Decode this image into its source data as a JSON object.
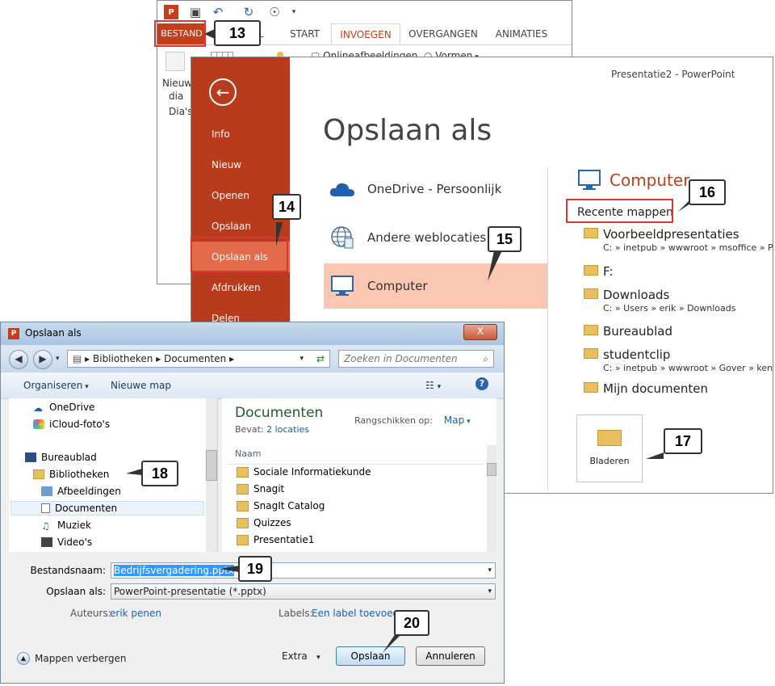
{
  "ppt_back": {
    "tabs": [
      "BESTAND",
      "START",
      "INVOEGEN",
      "OVERGANGEN",
      "ANIMATIES"
    ],
    "partial_tab": "L",
    "ribbon": {
      "new_slide_line1": "Nieuw",
      "new_slide_line2": "dia",
      "group_slides": "Dia's",
      "online_images": "Onlineafbeeldingen",
      "shapes": "Vormen"
    }
  },
  "backstage": {
    "window_title": "Presentatie2 - PowerPoint",
    "heading": "Opslaan als",
    "nav": [
      "Info",
      "Nieuw",
      "Openen",
      "Opslaan",
      "Opslaan als",
      "Afdrukken",
      "Delen"
    ],
    "places": [
      "OneDrive - Persoonlijk",
      "Andere weblocaties",
      "Computer"
    ],
    "computer_title": "Computer",
    "recent_label": "Recente mappen",
    "recent_folders": [
      {
        "name": "Voorbeeldpresentaties",
        "path": "C: » inetpub » wwwroot » msoffice » Pow"
      },
      {
        "name": "F:",
        "path": ""
      },
      {
        "name": "Downloads",
        "path": "C: » Users » erik » Downloads"
      },
      {
        "name": "Bureaublad",
        "path": ""
      },
      {
        "name": "studentclip",
        "path": "C: » inetpub » wwwroot » Gover » kenge"
      },
      {
        "name": "Mijn documenten",
        "path": ""
      }
    ],
    "browse_label": "Bladeren"
  },
  "dialog": {
    "title": "Opslaan als",
    "close": "X",
    "address": [
      "Bibliotheken",
      "Documenten"
    ],
    "search_placeholder": "Zoeken in Documenten",
    "toolbar": {
      "organize": "Organiseren",
      "new_folder": "Nieuwe map"
    },
    "tree": [
      "OneDrive",
      "iCloud-foto's",
      "Bureaublad",
      "Bibliotheken",
      "Afbeeldingen",
      "Documenten",
      "Muziek",
      "Video's"
    ],
    "library_title": "Documenten",
    "contains_label": "Bevat:",
    "contains_link": "2 locaties",
    "sort_label": "Rangschikken op:",
    "sort_value": "Map",
    "column_name": "Naam",
    "files": [
      "Sociale Informatiekunde",
      "Snagit",
      "SnagIt Catalog",
      "Quizzes",
      "Presentatie1"
    ],
    "filename_label": "Bestandsnaam:",
    "filename_value": "Bedrijfsvergadering.pptx",
    "savetype_label": "Opslaan als:",
    "savetype_value": "PowerPoint-presentatie (*.pptx)",
    "authors_label": "Auteurs:",
    "authors_value": "erik penen",
    "tags_label": "Labels:",
    "tags_value": "Een label toevoegen",
    "hide_folders": "Mappen verbergen",
    "extra": "Extra",
    "save_button": "Opslaan",
    "cancel_button": "Annuleren"
  },
  "callouts": [
    "13",
    "14",
    "15",
    "16",
    "17",
    "18",
    "19",
    "20"
  ],
  "colors": {
    "accent": "#c43e1c",
    "highlight_red": "#e03535",
    "selected_place": "#f9c7b2"
  }
}
